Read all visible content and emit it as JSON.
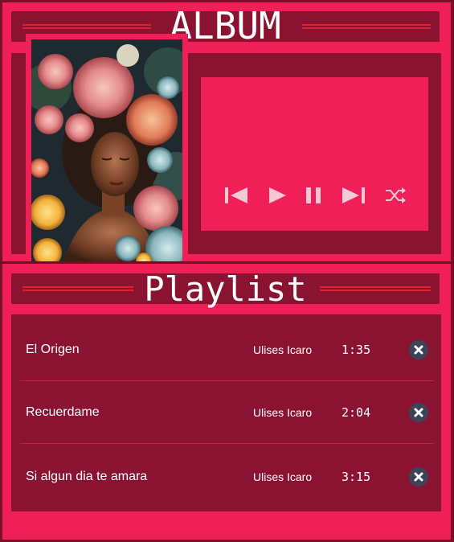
{
  "album": {
    "heading": "ALBUM",
    "cover_alt": "Album cover: woman surrounded by flowers"
  },
  "player": {
    "controls": [
      {
        "name": "previous-icon"
      },
      {
        "name": "play-icon"
      },
      {
        "name": "pause-icon"
      },
      {
        "name": "next-icon"
      },
      {
        "name": "shuffle-icon"
      }
    ]
  },
  "playlist": {
    "heading": "Playlist",
    "tracks": [
      {
        "title": "El Origen",
        "artist": "Ulises Icaro",
        "duration": "1:35"
      },
      {
        "title": "Recuerdame",
        "artist": "Ulises Icaro",
        "duration": "2:04"
      },
      {
        "title": "Si algun dia te amara",
        "artist": "Ulises Icaro",
        "duration": "3:15"
      }
    ]
  },
  "colors": {
    "primary": "#f01f58",
    "panel": "#8a1331",
    "accent_line": "#e0202b",
    "remove_button": "#3d4459",
    "icon": "#f2c9d4"
  }
}
